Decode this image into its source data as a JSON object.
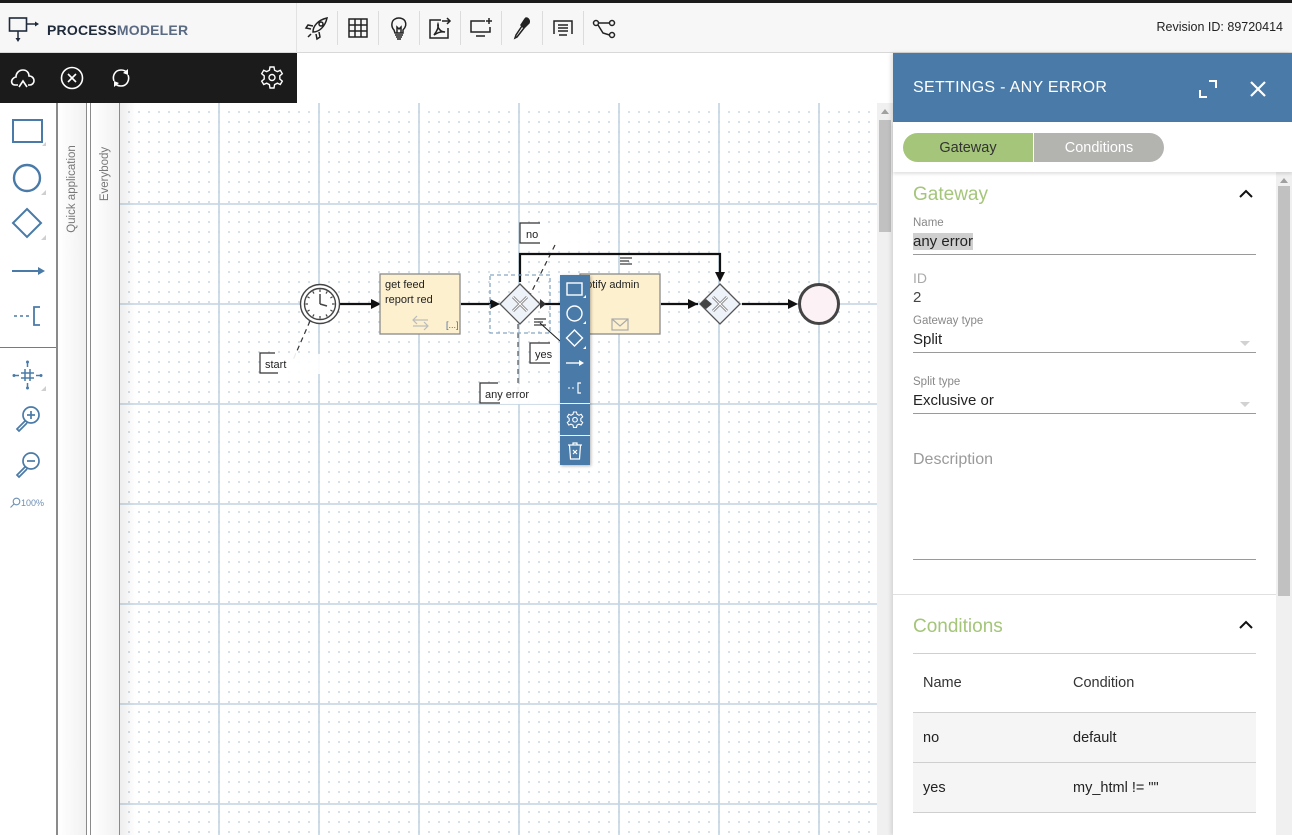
{
  "app": {
    "logo_text_bold": "PROCESS",
    "logo_text_light": "MODELER",
    "revision": "Revision ID: 89720414"
  },
  "toolbar": {
    "items": [
      {
        "icon": "rocket-icon",
        "label": "Deploy"
      },
      {
        "icon": "grid-icon",
        "label": "Table view"
      },
      {
        "icon": "lightbulb-icon",
        "label": "Tips"
      },
      {
        "icon": "pdf-export-icon",
        "label": "Export PDF"
      },
      {
        "icon": "add-screen-icon",
        "label": "Add screen"
      },
      {
        "icon": "eyedropper-icon",
        "label": "Color"
      },
      {
        "icon": "text-list-icon",
        "label": "Text"
      },
      {
        "icon": "share-icon",
        "label": "Share"
      }
    ]
  },
  "actionbar": {
    "items": [
      {
        "icon": "cloud-upload-icon",
        "label": "Save"
      },
      {
        "icon": "close-circle-icon",
        "label": "Discard"
      },
      {
        "icon": "refresh-icon",
        "label": "Reload"
      },
      {
        "icon": "gear-icon",
        "label": "Settings"
      }
    ]
  },
  "palette": {
    "items": [
      {
        "icon": "task-rectangle-icon",
        "label": "Task"
      },
      {
        "icon": "event-circle-icon",
        "label": "Event"
      },
      {
        "icon": "gateway-diamond-icon",
        "label": "Gateway"
      },
      {
        "icon": "sequence-flow-arrow-icon",
        "label": "Flow"
      },
      {
        "icon": "annotation-icon",
        "label": "Annotation"
      },
      {
        "icon": "move-grid-icon",
        "label": "Move"
      },
      {
        "icon": "zoom-in-icon",
        "label": "Zoom in"
      },
      {
        "icon": "zoom-out-icon",
        "label": "Zoom out"
      }
    ],
    "zoom_level": "100%"
  },
  "lanes": [
    {
      "label": "Quick application"
    },
    {
      "label": "Everybody"
    }
  ],
  "diagram": {
    "elements": [
      {
        "type": "timer-start-event",
        "label": "start"
      },
      {
        "type": "task",
        "label_lines": [
          "get feed",
          "report red"
        ]
      },
      {
        "type": "exclusive-gateway",
        "label": "any error",
        "selected": true
      },
      {
        "type": "task",
        "label_lines": [
          "notify admin"
        ]
      },
      {
        "type": "exclusive-gateway",
        "label": ""
      },
      {
        "type": "end-event",
        "label": ""
      }
    ],
    "flow_labels": [
      "no",
      "yes"
    ]
  },
  "contextpad": {
    "items": [
      {
        "icon": "task-rectangle-icon",
        "label": "Append task"
      },
      {
        "icon": "event-circle-icon",
        "label": "Append event"
      },
      {
        "icon": "gateway-diamond-icon",
        "label": "Append gateway"
      },
      {
        "icon": "sequence-flow-arrow-icon",
        "label": "Connect"
      },
      {
        "icon": "annotation-icon",
        "label": "Annotate"
      },
      {
        "icon": "gear-icon",
        "label": "Settings"
      },
      {
        "icon": "trash-icon",
        "label": "Delete"
      }
    ]
  },
  "panel": {
    "title": "SETTINGS  - ANY ERROR",
    "tabs": [
      {
        "label": "Gateway",
        "active": true
      },
      {
        "label": "Conditions",
        "active": false
      }
    ],
    "gateway_section": {
      "title": "Gateway",
      "name_label": "Name",
      "name_value": "any error",
      "id_label": "ID",
      "id_value": "2",
      "gateway_type_label": "Gateway type",
      "gateway_type_value": "Split",
      "split_type_label": "Split type",
      "split_type_value": "Exclusive or",
      "description_placeholder": "Description"
    },
    "conditions_section": {
      "title": "Conditions",
      "columns": [
        "Name",
        "Condition"
      ],
      "rows": [
        {
          "name": "no",
          "condition": "default"
        },
        {
          "name": "yes",
          "condition": "my_html != \"\""
        }
      ]
    }
  },
  "colors": {
    "accent_blue": "#4a7aa7",
    "accent_green": "#a4c57a",
    "tab_inactive": "#b3b3b0",
    "task_fill": "#fdf0cf",
    "dark_bar": "#1b1b1b"
  }
}
